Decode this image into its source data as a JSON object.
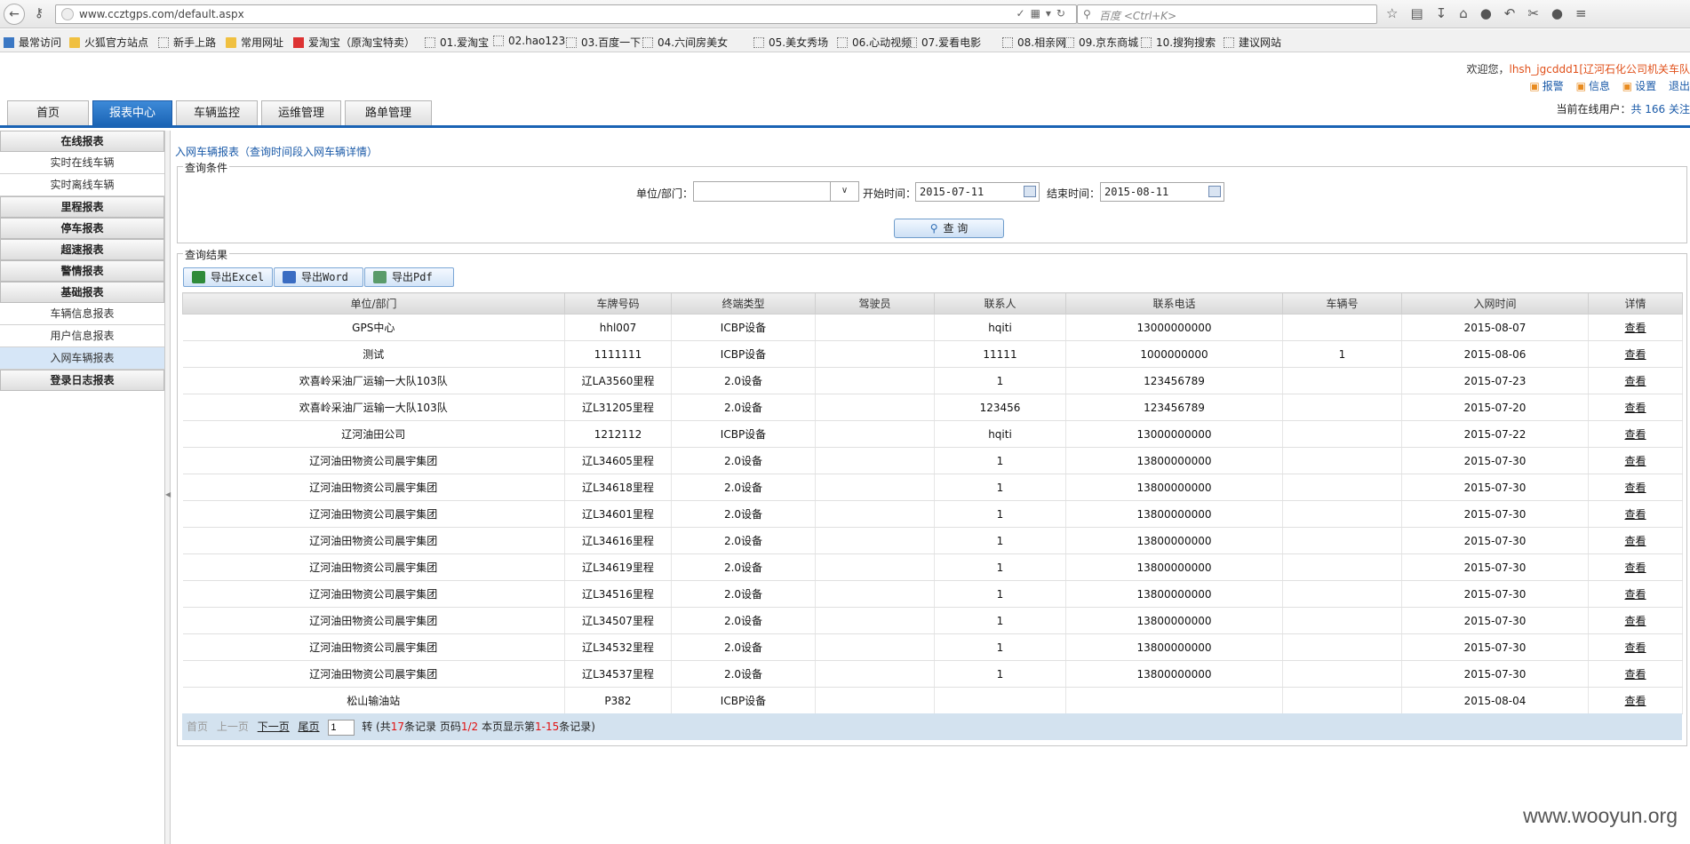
{
  "browser": {
    "url": "www.ccztgps.com/default.aspx",
    "search_placeholder": "百度 <Ctrl+K>",
    "bookmarks": [
      "最常访问",
      "火狐官方站点",
      "新手上路",
      "常用网址",
      "爱淘宝（原淘宝特卖）",
      "01.爱淘宝",
      "02.hao123",
      "03.百度一下",
      "04.六间房美女",
      "05.美女秀场",
      "06.心动视频",
      "07.爱看电影",
      "08.相亲网",
      "09.京东商城",
      "10.搜狗搜索",
      "建议网站"
    ]
  },
  "header": {
    "welcome": "欢迎您，",
    "user": "lhsh_jgcddd1[辽河石化公司机关车队",
    "links": [
      "报警",
      "信息",
      "设置",
      "退出"
    ],
    "online_label": "当前在线用户：",
    "online_value": "共 166 关注"
  },
  "tabs": [
    "首页",
    "报表中心",
    "车辆监控",
    "运维管理",
    "路单管理"
  ],
  "sidebar": [
    {
      "type": "grp",
      "label": "在线报表"
    },
    {
      "type": "item",
      "label": "实时在线车辆"
    },
    {
      "type": "item",
      "label": "实时离线车辆"
    },
    {
      "type": "grp",
      "label": "里程报表"
    },
    {
      "type": "grp",
      "label": "停车报表"
    },
    {
      "type": "grp",
      "label": "超速报表"
    },
    {
      "type": "grp",
      "label": "警情报表"
    },
    {
      "type": "grp",
      "label": "基础报表"
    },
    {
      "type": "item",
      "label": "车辆信息报表"
    },
    {
      "type": "item",
      "label": "用户信息报表"
    },
    {
      "type": "item",
      "label": "入网车辆报表",
      "active": true
    },
    {
      "type": "grp",
      "label": "登录日志报表"
    }
  ],
  "breadcrumb": "入网车辆报表（查询时间段入网车辆详情）",
  "query": {
    "legend": "查询条件",
    "unit_label": "单位/部门：",
    "start_label": "开始时间：",
    "start_value": "2015-07-11",
    "end_label": "结束时间：",
    "end_value": "2015-08-11",
    "button": "查 询"
  },
  "results": {
    "legend": "查询结果",
    "exports": [
      "导出Excel",
      "导出Word",
      "导出Pdf"
    ],
    "columns": [
      "单位/部门",
      "车牌号码",
      "终端类型",
      "驾驶员",
      "联系人",
      "联系电话",
      "车辆号",
      "入网时间",
      "详情"
    ],
    "rows": [
      [
        "GPS中心",
        "hhl007",
        "ICBP设备",
        "",
        "hqiti",
        "13000000000",
        "",
        "2015-08-07",
        "查看"
      ],
      [
        "测试",
        "1111111",
        "ICBP设备",
        "",
        "11111",
        "1000000000",
        "1",
        "2015-08-06",
        "查看"
      ],
      [
        "欢喜岭采油厂运输一大队103队",
        "辽LA3560里程",
        "2.0设备",
        "",
        "1",
        "123456789",
        "",
        "2015-07-23",
        "查看"
      ],
      [
        "欢喜岭采油厂运输一大队103队",
        "辽L31205里程",
        "2.0设备",
        "",
        "123456",
        "123456789",
        "",
        "2015-07-20",
        "查看"
      ],
      [
        "辽河油田公司",
        "1212112",
        "ICBP设备",
        "",
        "hqiti",
        "13000000000",
        "",
        "2015-07-22",
        "查看"
      ],
      [
        "辽河油田物资公司晨宇集团",
        "辽L34605里程",
        "2.0设备",
        "",
        "1",
        "13800000000",
        "",
        "2015-07-30",
        "查看"
      ],
      [
        "辽河油田物资公司晨宇集团",
        "辽L34618里程",
        "2.0设备",
        "",
        "1",
        "13800000000",
        "",
        "2015-07-30",
        "查看"
      ],
      [
        "辽河油田物资公司晨宇集团",
        "辽L34601里程",
        "2.0设备",
        "",
        "1",
        "13800000000",
        "",
        "2015-07-30",
        "查看"
      ],
      [
        "辽河油田物资公司晨宇集团",
        "辽L34616里程",
        "2.0设备",
        "",
        "1",
        "13800000000",
        "",
        "2015-07-30",
        "查看"
      ],
      [
        "辽河油田物资公司晨宇集团",
        "辽L34619里程",
        "2.0设备",
        "",
        "1",
        "13800000000",
        "",
        "2015-07-30",
        "查看"
      ],
      [
        "辽河油田物资公司晨宇集团",
        "辽L34516里程",
        "2.0设备",
        "",
        "1",
        "13800000000",
        "",
        "2015-07-30",
        "查看"
      ],
      [
        "辽河油田物资公司晨宇集团",
        "辽L34507里程",
        "2.0设备",
        "",
        "1",
        "13800000000",
        "",
        "2015-07-30",
        "查看"
      ],
      [
        "辽河油田物资公司晨宇集团",
        "辽L34532里程",
        "2.0设备",
        "",
        "1",
        "13800000000",
        "",
        "2015-07-30",
        "查看"
      ],
      [
        "辽河油田物资公司晨宇集团",
        "辽L34537里程",
        "2.0设备",
        "",
        "1",
        "13800000000",
        "",
        "2015-07-30",
        "查看"
      ],
      [
        "松山输油站",
        "P382",
        "ICBP设备",
        "",
        "",
        "",
        "",
        "2015-08-04",
        "查看"
      ]
    ]
  },
  "pager": {
    "first": "首页",
    "prev": "上一页",
    "next": "下一页",
    "last": "尾页",
    "page_input": "1",
    "go": "转",
    "t1": "(共",
    "total": "17",
    "t2": "条记录 页码",
    "page": "1/2",
    "t3": " 本页显示第",
    "range": "1-15",
    "t4": "条记录)"
  },
  "watermark": "www.wooyun.org"
}
